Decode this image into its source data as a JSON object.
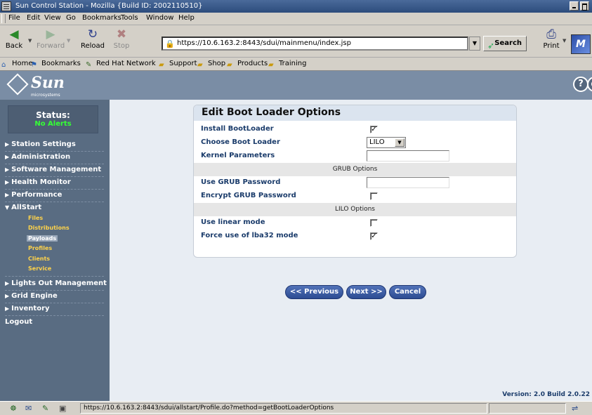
{
  "window": {
    "title": "Sun Control Station - Mozilla {Build ID: 2002110510}"
  },
  "menubar": {
    "items": [
      "File",
      "Edit",
      "View",
      "Go",
      "Bookmarks",
      "Tools",
      "Window",
      "Help"
    ]
  },
  "toolbar": {
    "back_label": "Back",
    "forward_label": "Forward",
    "reload_label": "Reload",
    "stop_label": "Stop",
    "url": "https://10.6.163.2:8443/sdui/mainmenu/index.jsp",
    "search_label": "Search",
    "print_label": "Print",
    "throbber_text": "M"
  },
  "personal_toolbar": {
    "items": [
      "Home",
      "Bookmarks",
      "Red Hat Network",
      "Support",
      "Shop",
      "Products",
      "Training"
    ]
  },
  "header": {
    "logo_text": "Sun",
    "logo_sub": "microsystems",
    "help_glyph": "?",
    "volume_glyph": "◐"
  },
  "sidebar": {
    "status_label": "Status:",
    "status_value": "No Alerts",
    "items": [
      {
        "label": "Station Settings",
        "expanded": false
      },
      {
        "label": "Administration",
        "expanded": false
      },
      {
        "label": "Software Management",
        "expanded": false
      },
      {
        "label": "Health Monitor",
        "expanded": false
      },
      {
        "label": "Performance",
        "expanded": false
      },
      {
        "label": "AllStart",
        "expanded": true
      },
      {
        "label": "Lights Out Management",
        "expanded": false
      },
      {
        "label": "Grid Engine",
        "expanded": false
      },
      {
        "label": "Inventory",
        "expanded": false
      },
      {
        "label": "Logout",
        "expanded": false
      }
    ],
    "allstart_subitems": [
      {
        "label": "Files",
        "active": false
      },
      {
        "label": "Distributions",
        "active": false
      },
      {
        "label": "Payloads",
        "active": true
      },
      {
        "label": "Profiles",
        "active": false
      },
      {
        "label": "Clients",
        "active": false
      },
      {
        "label": "Service",
        "active": false
      }
    ]
  },
  "form": {
    "title": "Edit Boot Loader Options",
    "install_bootloader": {
      "label": "Install BootLoader",
      "checked": true
    },
    "choose_boot_loader": {
      "label": "Choose Boot Loader",
      "value": "LILO"
    },
    "kernel_parameters": {
      "label": "Kernel Parameters",
      "value": ""
    },
    "grub_section": "GRUB Options",
    "use_grub_password": {
      "label": "Use GRUB Password",
      "value": ""
    },
    "encrypt_grub_password": {
      "label": "Encrypt GRUB Password",
      "checked": false
    },
    "lilo_section": "LILO Options",
    "use_linear_mode": {
      "label": "Use linear mode",
      "checked": false
    },
    "force_lba32": {
      "label": "Force use of lba32 mode",
      "checked": true
    },
    "check_glyph": "✓",
    "previous_label": "<< Previous",
    "next_label": "Next >>",
    "cancel_label": "Cancel"
  },
  "footer": {
    "version": "Version: 2.0 Build 2.0.22"
  },
  "statusbar": {
    "url": "https://10.6.163.2:8443/sdui/allstart/Profile.do?method=getBootLoaderOptions"
  }
}
